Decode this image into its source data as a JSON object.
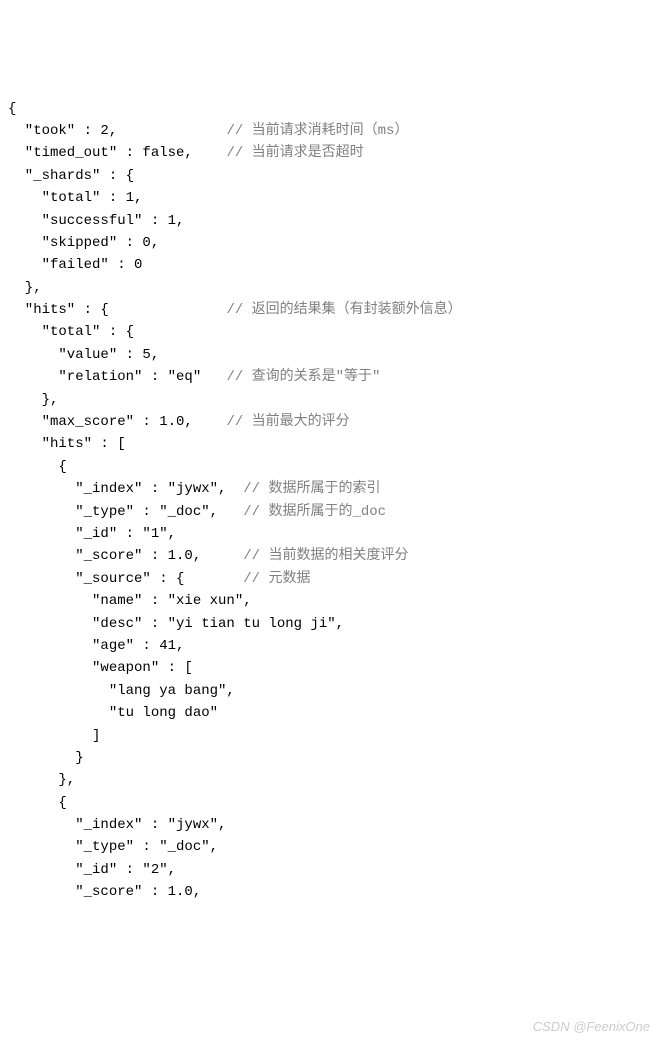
{
  "lines": [
    {
      "code": "{",
      "comment": ""
    },
    {
      "code": "  \"took\" : 2,",
      "comment": "// 当前请求消耗时间（ms）",
      "commentCol": 26
    },
    {
      "code": "  \"timed_out\" : false,",
      "comment": "// 当前请求是否超时",
      "commentCol": 26
    },
    {
      "code": "  \"_shards\" : {",
      "comment": ""
    },
    {
      "code": "    \"total\" : 1,",
      "comment": ""
    },
    {
      "code": "    \"successful\" : 1,",
      "comment": ""
    },
    {
      "code": "    \"skipped\" : 0,",
      "comment": ""
    },
    {
      "code": "    \"failed\" : 0",
      "comment": ""
    },
    {
      "code": "  },",
      "comment": ""
    },
    {
      "code": "  \"hits\" : {",
      "comment": "// 返回的结果集（有封装额外信息）",
      "commentCol": 26
    },
    {
      "code": "    \"total\" : {",
      "comment": ""
    },
    {
      "code": "      \"value\" : 5,",
      "comment": ""
    },
    {
      "code": "      \"relation\" : \"eq\"",
      "comment": "// 查询的关系是\"等于\"",
      "commentCol": 26
    },
    {
      "code": "    },",
      "comment": ""
    },
    {
      "code": "    \"max_score\" : 1.0,",
      "comment": "// 当前最大的评分",
      "commentCol": 26
    },
    {
      "code": "    \"hits\" : [",
      "comment": ""
    },
    {
      "code": "      {",
      "comment": ""
    },
    {
      "code": "        \"_index\" : \"jywx\",",
      "comment": "// 数据所属于的索引",
      "commentCol": 28
    },
    {
      "code": "        \"_type\" : \"_doc\",",
      "comment": "// 数据所属于的_doc",
      "commentCol": 28
    },
    {
      "code": "        \"_id\" : \"1\",",
      "comment": ""
    },
    {
      "code": "        \"_score\" : 1.0,",
      "comment": "// 当前数据的相关度评分",
      "commentCol": 28
    },
    {
      "code": "        \"_source\" : {",
      "comment": "// 元数据",
      "commentCol": 28
    },
    {
      "code": "          \"name\" : \"xie xun\",",
      "comment": ""
    },
    {
      "code": "          \"desc\" : \"yi tian tu long ji\",",
      "comment": ""
    },
    {
      "code": "          \"age\" : 41,",
      "comment": ""
    },
    {
      "code": "          \"weapon\" : [",
      "comment": ""
    },
    {
      "code": "            \"lang ya bang\",",
      "comment": ""
    },
    {
      "code": "            \"tu long dao\"",
      "comment": ""
    },
    {
      "code": "          ]",
      "comment": ""
    },
    {
      "code": "        }",
      "comment": ""
    },
    {
      "code": "      },",
      "comment": ""
    },
    {
      "code": "      {",
      "comment": ""
    },
    {
      "code": "        \"_index\" : \"jywx\",",
      "comment": ""
    },
    {
      "code": "        \"_type\" : \"_doc\",",
      "comment": ""
    },
    {
      "code": "        \"_id\" : \"2\",",
      "comment": ""
    },
    {
      "code": "        \"_score\" : 1.0,",
      "comment": ""
    }
  ],
  "watermark": "CSDN @FeenixOne"
}
